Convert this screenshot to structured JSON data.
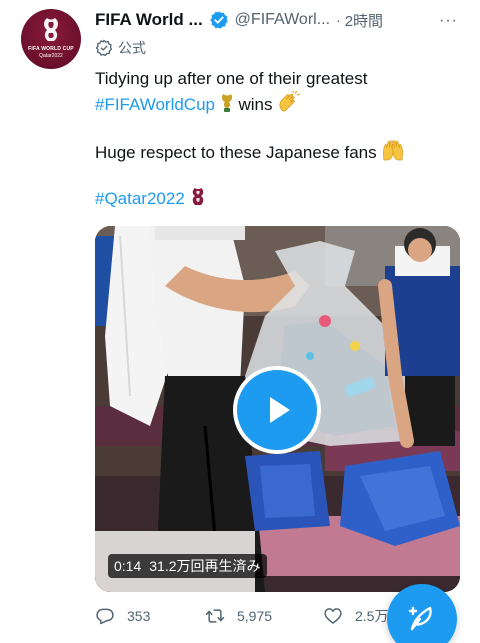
{
  "account": {
    "name": "FIFA World ...",
    "handle": "@FIFAWorl...",
    "separator": "·",
    "time": "2時間",
    "more": "···",
    "official_label": "公式",
    "avatar_line1": "FIFA WORLD CUP",
    "avatar_line2": "Qatar2022"
  },
  "tweet": {
    "line1": "Tidying up after one of their greatest",
    "hashtag1": "#FIFAWorldCup",
    "line2_suffix": " wins ",
    "line3": "Huge respect to these Japanese fans ",
    "hashtag2": "#Qatar2022"
  },
  "media": {
    "duration": "0:14",
    "views": "31.2万回再生済み"
  },
  "actions": {
    "reply_count": "353",
    "retweet_count": "5,975",
    "like_count": "2.5万"
  },
  "colors": {
    "accent": "#1d9bf0",
    "text": "#0f1419",
    "muted": "#536471",
    "avatar": "#6a0f2d"
  },
  "icons": {
    "verified": "verified-badge-icon",
    "official": "official-badge-icon",
    "reply": "reply-icon",
    "retweet": "retweet-icon",
    "like": "heart-icon",
    "compose": "compose-feather-icon",
    "play": "play-icon"
  }
}
